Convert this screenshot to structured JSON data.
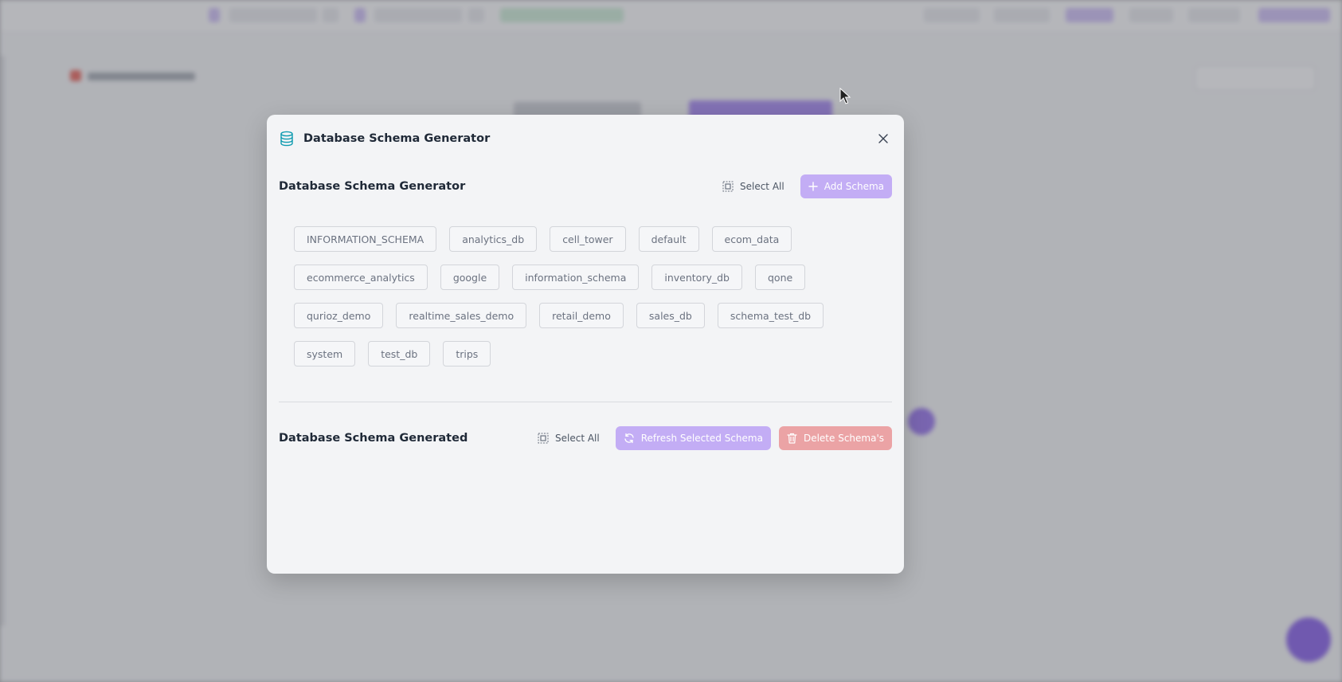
{
  "modal": {
    "title": "Database Schema Generator",
    "generator_section": {
      "title": "Database Schema Generator",
      "select_all_label": "Select All",
      "add_button_label": "Add Schema"
    },
    "schemas": [
      [
        "INFORMATION_SCHEMA",
        "analytics_db",
        "cell_tower",
        "default",
        "ecom_data"
      ],
      [
        "ecommerce_analytics",
        "google",
        "information_schema",
        "inventory_db",
        "qone"
      ],
      [
        "qurioz_demo",
        "realtime_sales_demo",
        "retail_demo",
        "sales_db",
        "schema_test_db"
      ],
      [
        "system",
        "test_db",
        "trips"
      ]
    ],
    "generated_section": {
      "title": "Database Schema Generated",
      "select_all_label": "Select All",
      "refresh_button_label": "Refresh Selected Schema",
      "delete_button_label": "Delete Schema's"
    }
  },
  "icons": {
    "header": "database-icon",
    "close": "close-icon",
    "select_all": "select-all-icon",
    "add": "plus-icon",
    "refresh": "refresh-icon",
    "delete": "trash-icon"
  },
  "colors": {
    "accent_purple": "#c3adf5",
    "danger_red": "#eba3a5",
    "icon_teal": "#0e9bb0",
    "modal_bg": "#f3f4f6"
  }
}
